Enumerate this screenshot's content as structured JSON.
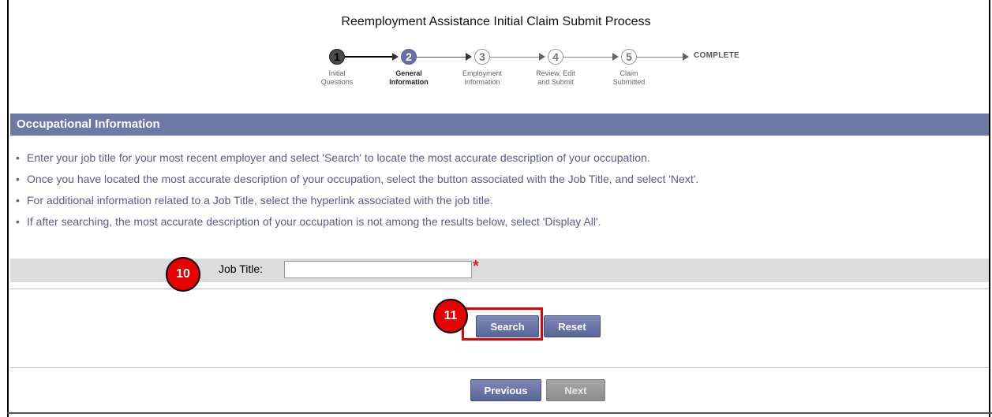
{
  "page_title": "Reemployment Assistance Initial Claim Submit Process",
  "stepper": {
    "steps": [
      {
        "number": "1",
        "label": "Initial\nQuestions",
        "state": "done"
      },
      {
        "number": "2",
        "label": "General\nInformation",
        "state": "current"
      },
      {
        "number": "3",
        "label": "Employment\nInformation",
        "state": "future"
      },
      {
        "number": "4",
        "label": "Review, Edit\nand Submit",
        "state": "future"
      },
      {
        "number": "5",
        "label": "Claim\nSubmitted",
        "state": "future"
      }
    ],
    "complete_label": "COMPLETE"
  },
  "section": {
    "title": "Occupational Information",
    "instructions": [
      "Enter your job title for your most recent employer and select 'Search' to locate the most accurate description of your occupation.",
      "Once you have located the most accurate description of your occupation, select the button associated with the Job Title, and select 'Next'.",
      "For additional information related to a Job Title, select the hyperlink associated with the job title.",
      "If after searching, the most accurate description of your occupation is not among the results below, select 'Display All'."
    ]
  },
  "form": {
    "job_title_label": "Job Title:",
    "job_title_value": "",
    "required_mark": "*"
  },
  "buttons": {
    "search": "Search",
    "reset": "Reset",
    "previous": "Previous",
    "next": "Next"
  },
  "callouts": {
    "first": "10",
    "second": "11"
  },
  "colors": {
    "header_bar": "#6e7aa6",
    "button": "#5a6598",
    "callout": "#e60000",
    "instruction_text": "#5a5a8c"
  }
}
